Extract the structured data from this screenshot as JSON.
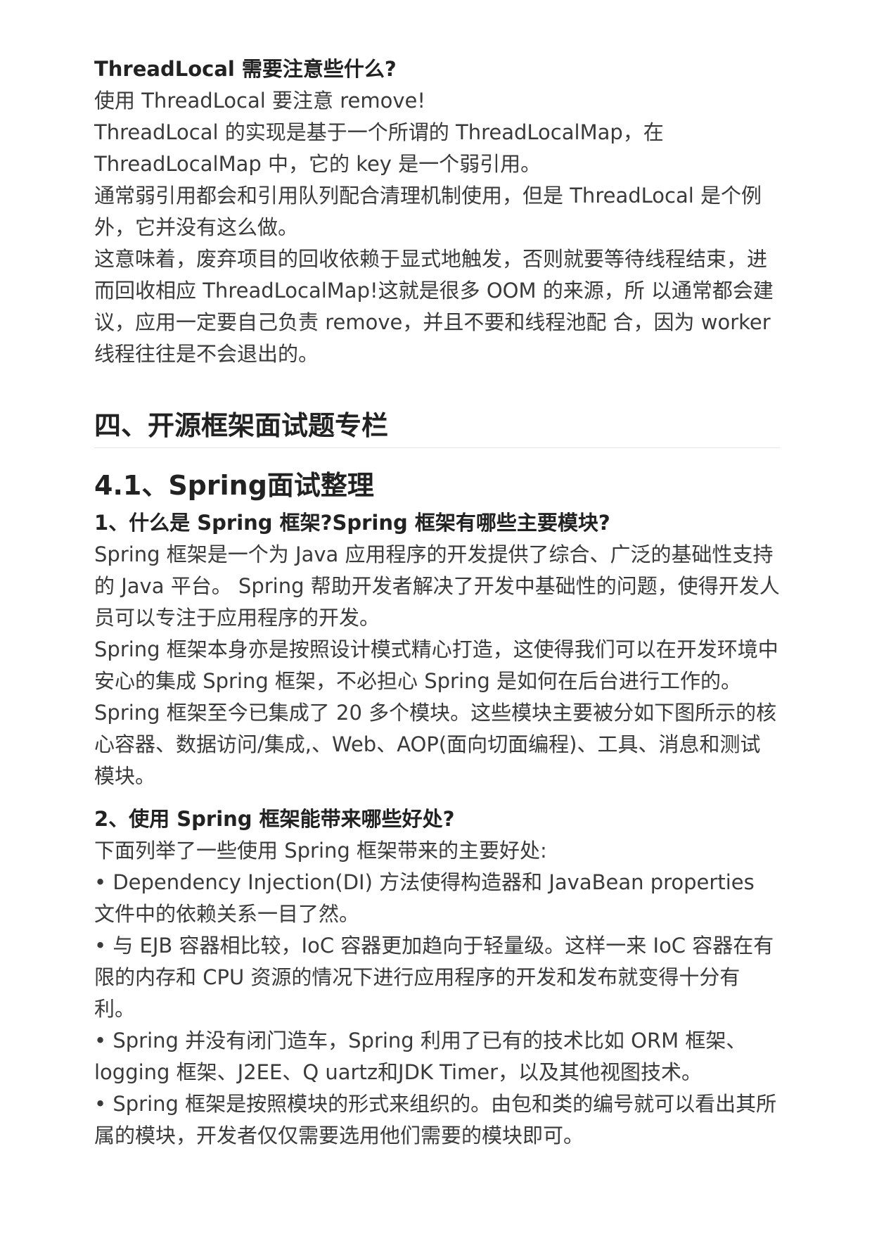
{
  "threadlocal": {
    "heading": "ThreadLocal 需要注意些什么?",
    "paragraphs": [
      "使用 ThreadLocal 要注意 remove!",
      "ThreadLocal 的实现是基于一个所谓的 ThreadLocalMap，在 ThreadLocalMap 中，它的 key 是一个弱引用。",
      "通常弱引用都会和引用队列配合清理机制使用，但是 ThreadLocal 是个例外，它并没有这么做。",
      "这意味着，废弃项目的回收依赖于显式地触发，否则就要等待线程结束，进而回收相应 ThreadLocalMap!这就是很多 OOM 的来源，所 以通常都会建议，应用一定要自己负责 remove，并且不要和线程池配 合，因为 worker 线程往往是不会退出的。"
    ]
  },
  "section4": {
    "title": "四、开源框架面试题专栏"
  },
  "section41": {
    "title": "4.1、Spring面试整理"
  },
  "q1": {
    "heading": "1、什么是 Spring 框架?Spring 框架有哪些主要模块?",
    "paragraphs": [
      "Spring 框架是一个为 Java 应用程序的开发提供了综合、广泛的基础性支持的 Java 平台。 Spring 帮助开发者解决了开发中基础性的问题，使得开发人员可以专注于应用程序的开发。",
      "Spring 框架本身亦是按照设计模式精心打造，这使得我们可以在开发环境中安心的集成 Spring 框架，不必担心 Spring 是如何在后台进行工作的。",
      "Spring 框架至今已集成了 20 多个模块。这些模块主要被分如下图所示的核心容器、数据访问/集成,、Web、AOP(面向切面编程)、工具、消息和测试模块。"
    ]
  },
  "q2": {
    "heading": "2、使用 Spring 框架能带来哪些好处?",
    "intro": "下面列举了一些使用 Spring 框架带来的主要好处:",
    "bullets": [
      "• Dependency Injection(DI) 方法使得构造器和 JavaBean properties 文件中的依赖关系一目了然。",
      "• 与 EJB 容器相比较，IoC 容器更加趋向于轻量级。这样一来 IoC 容器在有限的内存和 CPU 资源的情况下进行应用程序的开发和发布就变得十分有利。",
      "• Spring 并没有闭门造车，Spring 利用了已有的技术比如 ORM 框架、logging 框架、J2EE、Q uartz和JDK Timer，以及其他视图技术。",
      "• Spring 框架是按照模块的形式来组织的。由包和类的编号就可以看出其所属的模块，开发者仅仅需要选用他们需要的模块即可。"
    ]
  }
}
